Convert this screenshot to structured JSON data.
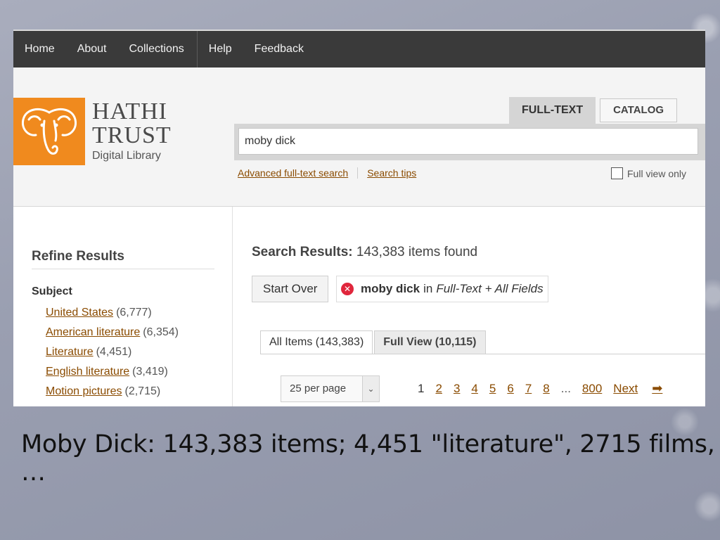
{
  "nav": {
    "items": [
      "Home",
      "About",
      "Collections",
      "Help",
      "Feedback"
    ]
  },
  "logo": {
    "line1": "HATHI",
    "line2": "TRUST",
    "line3": "Digital Library",
    "color": "#f08a1e"
  },
  "search": {
    "tabs": [
      {
        "label": "FULL-TEXT",
        "active": true
      },
      {
        "label": "CATALOG",
        "active": false
      }
    ],
    "query": "moby dick",
    "advanced_link": "Advanced full-text search",
    "tips_link": "Search tips",
    "full_view_only": "Full view only"
  },
  "sidebar": {
    "title": "Refine Results",
    "facet_heading": "Subject",
    "facets": [
      {
        "label": "United States",
        "count": "(6,777)"
      },
      {
        "label": "American literature",
        "count": "(6,354)"
      },
      {
        "label": "Literature",
        "count": "(4,451)"
      },
      {
        "label": "English literature",
        "count": "(3,419)"
      },
      {
        "label": "Motion pictures",
        "count": "(2,715)"
      }
    ]
  },
  "results": {
    "title_bold": "Search Results:",
    "title_rest": " 143,383 items found",
    "start_over": "Start Over",
    "chip": {
      "term": "moby dick",
      "in": "in",
      "fields": "Full-Text + All Fields"
    },
    "tabs": [
      {
        "label": "All Items (143,383)",
        "active": true
      },
      {
        "label": "Full View (10,115)",
        "active": false
      }
    ],
    "per_page": "25 per page",
    "pager": {
      "current": "1",
      "pages": [
        "2",
        "3",
        "4",
        "5",
        "6",
        "7",
        "8"
      ],
      "ellipsis": "...",
      "last": "800",
      "next": "Next"
    }
  },
  "caption": "Moby Dick: 143,383 items; 4,451 \"literature\", 2715 films, …"
}
